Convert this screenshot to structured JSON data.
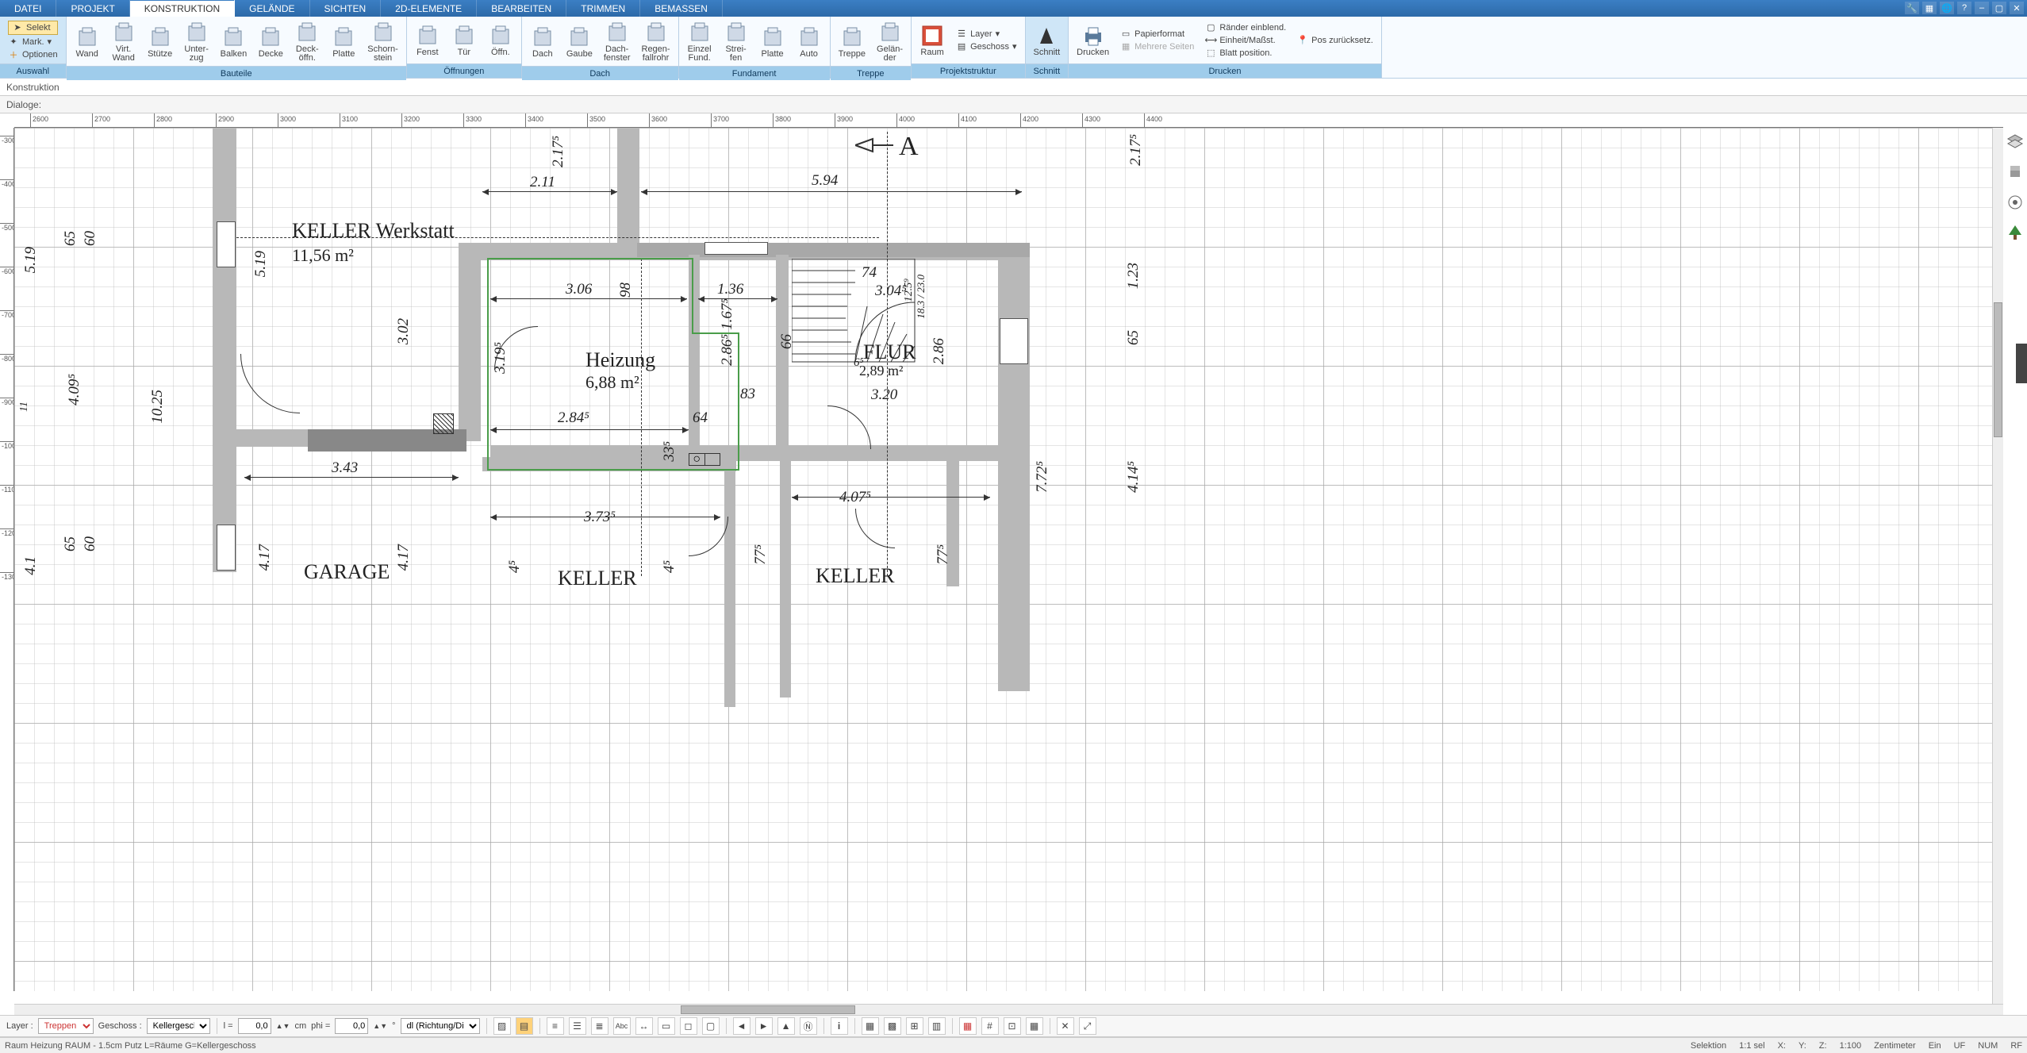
{
  "menubar": {
    "tabs": [
      "DATEI",
      "PROJEKT",
      "KONSTRUKTION",
      "GELÄNDE",
      "SICHTEN",
      "2D-ELEMENTE",
      "BEARBEITEN",
      "TRIMMEN",
      "BEMASSEN"
    ],
    "active_index": 2
  },
  "ribbon": {
    "auswahl": {
      "label": "Auswahl",
      "selekt": "Selekt",
      "mark": "Mark.",
      "optionen": "Optionen"
    },
    "bauteile": {
      "label": "Bauteile",
      "items": [
        {
          "id": "wand",
          "l1": "Wand",
          "l2": ""
        },
        {
          "id": "virt-wand",
          "l1": "Virt.",
          "l2": "Wand"
        },
        {
          "id": "stuetze",
          "l1": "Stütze",
          "l2": ""
        },
        {
          "id": "unterzug",
          "l1": "Unter-",
          "l2": "zug"
        },
        {
          "id": "balken",
          "l1": "Balken",
          "l2": ""
        },
        {
          "id": "decke",
          "l1": "Decke",
          "l2": ""
        },
        {
          "id": "deckoeffn",
          "l1": "Deck-",
          "l2": "öffn."
        },
        {
          "id": "platte",
          "l1": "Platte",
          "l2": ""
        },
        {
          "id": "schornstein",
          "l1": "Schorn-",
          "l2": "stein"
        }
      ]
    },
    "oeffnungen": {
      "label": "Öffnungen",
      "items": [
        {
          "id": "fenst",
          "l1": "Fenst",
          "l2": ""
        },
        {
          "id": "tuer",
          "l1": "Tür",
          "l2": ""
        },
        {
          "id": "oeffn",
          "l1": "Öffn.",
          "l2": ""
        }
      ]
    },
    "dach": {
      "label": "Dach",
      "items": [
        {
          "id": "dach",
          "l1": "Dach",
          "l2": ""
        },
        {
          "id": "gaube",
          "l1": "Gaube",
          "l2": ""
        },
        {
          "id": "dachfenster",
          "l1": "Dach-",
          "l2": "fenster"
        },
        {
          "id": "regenfallrohr",
          "l1": "Regen-",
          "l2": "fallrohr"
        }
      ]
    },
    "fundament": {
      "label": "Fundament",
      "items": [
        {
          "id": "einzelfund",
          "l1": "Einzel",
          "l2": "Fund."
        },
        {
          "id": "streifen",
          "l1": "Strei-",
          "l2": "fen"
        },
        {
          "id": "platte2",
          "l1": "Platte",
          "l2": ""
        },
        {
          "id": "auto",
          "l1": "Auto",
          "l2": ""
        }
      ]
    },
    "treppe": {
      "label": "Treppe",
      "items": [
        {
          "id": "treppe",
          "l1": "Treppe",
          "l2": ""
        },
        {
          "id": "gelaender",
          "l1": "Gelän-",
          "l2": "der"
        }
      ]
    },
    "projektstruktur": {
      "label": "Projektstruktur",
      "raum": "Raum",
      "layer": "Layer",
      "geschoss": "Geschoss"
    },
    "schnitt": {
      "label": "Schnitt",
      "schnitt": "Schnitt"
    },
    "drucken": {
      "label": "Drucken",
      "drucken": "Drucken",
      "papierformat": "Papierformat",
      "mehrere_seiten": "Mehrere Seiten",
      "raender": "Ränder einblend.",
      "einheit": "Einheit/Maßst.",
      "blatt": "Blatt position.",
      "pos": "Pos zurücksetz."
    }
  },
  "subbar1": "Konstruktion",
  "subbar2_label": "Dialoge:",
  "ruler_h": [
    "2600",
    "2700",
    "2800",
    "2900",
    "3000",
    "3100",
    "3200",
    "3300",
    "3400",
    "3500",
    "3600",
    "3700",
    "3800",
    "3900",
    "4000",
    "4100",
    "4200",
    "4300",
    "4400"
  ],
  "ruler_v": [
    "-300",
    "-400",
    "-500",
    "-600",
    "-700",
    "-800",
    "-900",
    "-1000",
    "-1100",
    "-1200",
    "-1300"
  ],
  "rooms": {
    "werkstatt": {
      "name": "KELLER Werkstatt",
      "area": "11,56 m²"
    },
    "heizung": {
      "name": "Heizung",
      "area": "6,88 m²"
    },
    "flur": {
      "name": "FLUR",
      "area": "2,89 m²"
    },
    "garage": {
      "name": "GARAGE"
    },
    "keller1": {
      "name": "KELLER"
    },
    "keller2": {
      "name": "KELLER"
    }
  },
  "dims": {
    "d211": "2.11",
    "d2175": "2.17⁵",
    "d594": "5.94",
    "d306": "3.06",
    "d98": "98",
    "d136": "1.36",
    "d167": "1.67⁵",
    "d286": "2.86⁵",
    "d66": "66",
    "d304": "3.04⁵",
    "d74": "74",
    "d123": "1.23",
    "d183": "18.3 / 23.0",
    "d125": "12.5⁹",
    "d2175r": "2.17⁵",
    "d65r": "65",
    "d65l": "65",
    "d60l": "60",
    "d519": "5.19",
    "d519r": "5.19",
    "d409": "4.09⁵",
    "d1025": "10.25",
    "d302": "3.02",
    "d3195": "3.19⁵",
    "d2845": "2.84⁵",
    "d64": "64",
    "d83": "83",
    "d286r": "2.86",
    "d320": "3.20",
    "d335": "33⁵",
    "d343": "3.43",
    "d3735": "3.73⁵",
    "d4075": "4.07⁵",
    "d775a": "77⁵",
    "d775b": "77⁵",
    "d65b": "65",
    "d60b": "60",
    "d417a": "4.17",
    "d417b": "4.17",
    "d41": "4.1",
    "d11": "11",
    "d45": "4⁵",
    "d45b": "4⁵",
    "d7725": "7.72⁵",
    "d4145": "4.14⁵",
    "d289": "2,89 m²",
    "d65c": "6⁵"
  },
  "north_label": "A",
  "toolbar_bottom": {
    "layer_label": "Layer :",
    "layer_value": "Treppen",
    "geschoss_label": "Geschoss :",
    "geschoss_value": "Kellergesch",
    "l_label": "l =",
    "l_value": "0,0",
    "l_unit": "cm",
    "phi_label": "phi =",
    "phi_value": "0,0",
    "dl_value": "dl (Richtung/Di"
  },
  "statusbar": {
    "left": "Raum Heizung RAUM - 1.5cm Putz L=Räume G=Kellergeschoss",
    "selektion": "Selektion",
    "sel": "1:1 sel",
    "x": "X:",
    "y": "Y:",
    "z": "Z:",
    "scale": "1:100",
    "unit": "Zentimeter",
    "ein": "Ein",
    "uf": "UF",
    "num": "NUM",
    "rf": "RF"
  }
}
